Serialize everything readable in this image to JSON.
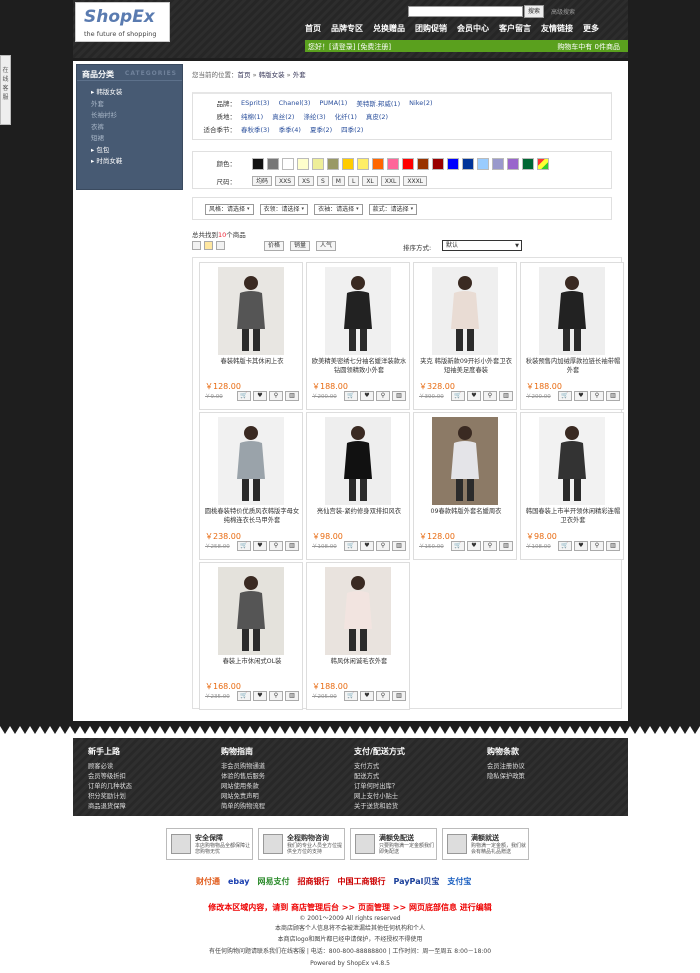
{
  "feedback": {
    "label": "在线客服"
  },
  "header": {
    "logo": "ShopEx",
    "tagline": "the future of shopping",
    "search_button": "搜索",
    "adv_search": "高级搜索",
    "nav": [
      "首页",
      "品牌专区",
      "兑换赠品",
      "团购促销",
      "会员中心",
      "客户留言",
      "友情链接",
      "更多"
    ],
    "welcome": "您好！[请登录] [免费注册]",
    "cart": "购物车中有 0件商品"
  },
  "sidebar": {
    "title": "商品分类",
    "title_en": "CATEGORIES",
    "items": [
      {
        "label": "韩版女装",
        "level": 1
      },
      {
        "label": "外套",
        "level": 2
      },
      {
        "label": "长袖衬衫",
        "level": 2
      },
      {
        "label": "衣裤",
        "level": 2
      },
      {
        "label": "短裙",
        "level": 2
      },
      {
        "label": "包包",
        "level": 1
      },
      {
        "label": "时尚女鞋",
        "level": 1
      }
    ]
  },
  "breadcrumb": {
    "prefix": "您当前的位置：",
    "items": [
      "首页",
      "韩版女装",
      "外套"
    ]
  },
  "attributes": [
    {
      "key": "品牌：",
      "values": [
        "ESprit(3)",
        "Chanel(3)",
        "PUMA(1)",
        "美特斯.邦威(1)",
        "Nike(2)"
      ]
    },
    {
      "key": "质地：",
      "values": [
        "纯棉(1)",
        "真丝(2)",
        "涤纶(3)",
        "化纤(1)",
        "真皮(2)"
      ]
    },
    {
      "key": "适合季节：",
      "values": [
        "春秋季(3)",
        "季季(4)",
        "夏季(2)",
        "四季(2)"
      ]
    }
  ],
  "colors": {
    "label": "颜色：",
    "swatches": [
      "#111111",
      "#777777",
      "#ffffff",
      "#ffffcc",
      "#eeee99",
      "#999966",
      "#ffcc00",
      "#ffee66",
      "#ff6600",
      "#ff6699",
      "#ff0000",
      "#993300",
      "#990000",
      "#0000ff",
      "#003399",
      "#99ccff",
      "#9999cc",
      "#9966cc",
      "#006633",
      "#multi"
    ]
  },
  "sizes": {
    "label": "尺码：",
    "values": [
      "均码",
      "XXS",
      "XS",
      "S",
      "M",
      "L",
      "XL",
      "XXL",
      "XXXL"
    ]
  },
  "filters": [
    {
      "label": "风格：请选择"
    },
    {
      "label": "衣领：请选择"
    },
    {
      "label": "衣袖：请选择"
    },
    {
      "label": "款式：请选择"
    }
  ],
  "count": {
    "prefix": "总共找到",
    "num": "10",
    "suffix": "个商品"
  },
  "sort": {
    "buttons": [
      "价格",
      "销量",
      "人气"
    ],
    "label": "排序方式:",
    "selected": "默认"
  },
  "products": [
    {
      "name": "春装韩版卡其休闲上衣",
      "price": "￥128.00",
      "old": "￥9.00"
    },
    {
      "name": "欧美精美密绣七分袖名媛洋装款水钻圆领精致小外套",
      "price": "￥188.00",
      "old": "￥200.00"
    },
    {
      "name": "夹克 韩版新款09开衫小外套卫衣短袖美足度春装",
      "price": "￥328.00",
      "old": "￥390.00"
    },
    {
      "name": "秋装预售内加绒厚款拉链长袖带帽外套",
      "price": "￥188.00",
      "old": "￥200.00"
    },
    {
      "name": "圆桃春装特价优质风衣韩版字母女纯棉连衣长马甲外套",
      "price": "￥238.00",
      "old": "￥258.00"
    },
    {
      "name": "亮仙宫装-紧约修身双排扣风衣",
      "price": "￥98.00",
      "old": "￥108.00"
    },
    {
      "name": "09春款韩版外套名媛周衣",
      "price": "￥128.00",
      "old": "￥150.00"
    },
    {
      "name": "韩国春装上市半开领休闲精彩连帽卫衣外套",
      "price": "￥98.00",
      "old": "￥108.00"
    },
    {
      "name": "春装上市休闲式OL装",
      "price": "￥168.00",
      "old": "￥235.00"
    },
    {
      "name": "韩风休闲诚毛衣外套",
      "price": "￥188.00",
      "old": "￥205.00"
    }
  ],
  "footer": {
    "cols": [
      {
        "title": "新手上路",
        "items": [
          "顾客必读",
          "会员等级折扣",
          "订单的几种状态",
          "积分奖励计划",
          "商品退货保障"
        ]
      },
      {
        "title": "购物指南",
        "items": [
          "非会员购物通道",
          "体验的售后服务",
          "网站使用条款",
          "网站免责声明",
          "简单的购物流程"
        ]
      },
      {
        "title": "支付/配送方式",
        "items": [
          "支付方式",
          "配送方式",
          "订单何时出库？",
          "网上支付小贴士",
          "关于送货和验货"
        ]
      },
      {
        "title": "购物条款",
        "items": [
          "会员注册协议",
          "隐私保护政策"
        ]
      }
    ]
  },
  "services": [
    {
      "title": "安全保障",
      "desc": "本店购物物品全都保障让您购物无忧"
    },
    {
      "title": "全程购物咨询",
      "desc": "我们的专业人员全方位提供全方位的支持"
    },
    {
      "title": "满额免配送",
      "desc": "只要购物满一定金额我们即免配送"
    },
    {
      "title": "满额就送",
      "desc": "购物满一定金额，我们就会有精品礼品赠送"
    }
  ],
  "pays": [
    "财付通",
    "ebay",
    "网易支付",
    "招商银行",
    "中国工商银行",
    "PayPal贝宝",
    "支付宝"
  ],
  "admin": "修改本区域内容，请到 商店管理后台 >> 页面管理 >> 网页底部信息 进行编辑",
  "copy": "© 2001～2009 All rights reserved",
  "line1": "本商店顾客个人信息将不会被泄漏给其他任何机构和个人",
  "line2": "本商店logo和图片都已经申请保护，不经授权不得使用",
  "line3": "有任何购物问题请联系我们在线客服 | 电话：800-800-88888800 | 工作时间：周一至周五 8:00－18:00",
  "powered": "Powered by ShopEx v4.8.5"
}
